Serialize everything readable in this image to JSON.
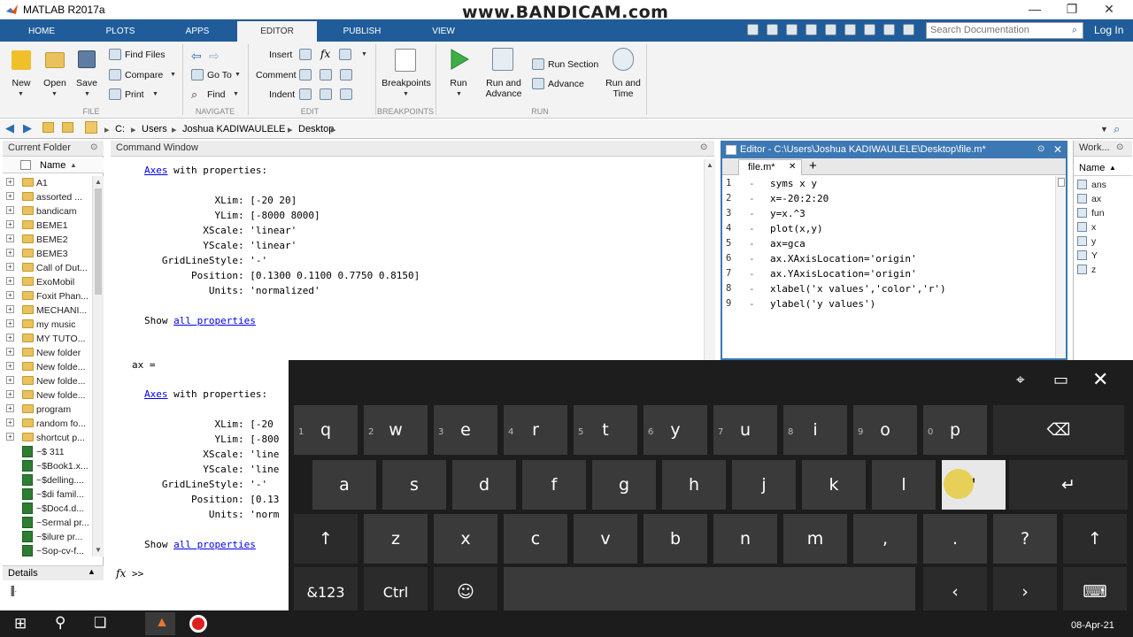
{
  "title": "MATLAB R2017a",
  "watermark": "www.BANDICAM.com",
  "tabs": [
    "HOME",
    "PLOTS",
    "APPS",
    "EDITOR",
    "PUBLISH",
    "VIEW"
  ],
  "search_placeholder": "Search Documentation",
  "login": "Log In",
  "ribbon": {
    "file": {
      "new": "New",
      "open": "Open",
      "save": "Save",
      "find_files": "Find Files",
      "compare": "Compare",
      "print": "Print",
      "group": "FILE"
    },
    "navigate": {
      "goto": "Go To",
      "find": "Find",
      "group": "NAVIGATE"
    },
    "edit": {
      "insert": "Insert",
      "comment": "Comment",
      "indent": "Indent",
      "fx": "fx",
      "group": "EDIT"
    },
    "breakpoints": {
      "label": "Breakpoints",
      "group": "BREAKPOINTS"
    },
    "run": {
      "run": "Run",
      "run_advance": "Run and Advance",
      "run_section": "Run Section",
      "advance": "Advance",
      "run_time": "Run and Time",
      "group": "RUN"
    }
  },
  "address": [
    "C:",
    "Users",
    "Joshua KADIWAULELE",
    "Desktop"
  ],
  "folder": {
    "title": "Current Folder",
    "col": "Name",
    "items": [
      {
        "name": "A1",
        "type": "folder"
      },
      {
        "name": "assorted ...",
        "type": "folder"
      },
      {
        "name": "bandicam",
        "type": "folder"
      },
      {
        "name": "BEME1",
        "type": "folder"
      },
      {
        "name": "BEME2",
        "type": "folder"
      },
      {
        "name": "BEME3",
        "type": "folder"
      },
      {
        "name": "Call of Dut...",
        "type": "folder"
      },
      {
        "name": "ExoMobil",
        "type": "folder"
      },
      {
        "name": "Foxit Phan...",
        "type": "folder"
      },
      {
        "name": "MECHANI...",
        "type": "folder"
      },
      {
        "name": "my music",
        "type": "folder"
      },
      {
        "name": "MY TUTO...",
        "type": "folder"
      },
      {
        "name": "New folder",
        "type": "folder"
      },
      {
        "name": "New folde...",
        "type": "folder"
      },
      {
        "name": "New folde...",
        "type": "folder"
      },
      {
        "name": "New folde...",
        "type": "folder"
      },
      {
        "name": "program",
        "type": "folder"
      },
      {
        "name": "random fo...",
        "type": "folder"
      },
      {
        "name": "shortcut p...",
        "type": "folder"
      },
      {
        "name": "~$ 311",
        "type": "file"
      },
      {
        "name": "~$Book1.x...",
        "type": "file"
      },
      {
        "name": "~$delling....",
        "type": "file"
      },
      {
        "name": "~$di famil...",
        "type": "file"
      },
      {
        "name": "~$Doc4.d...",
        "type": "file"
      },
      {
        "name": "~Sermal pr...",
        "type": "file"
      },
      {
        "name": "~$ilure pr...",
        "type": "file"
      },
      {
        "name": "~Sop-cv-f...",
        "type": "file"
      }
    ],
    "details": "Details"
  },
  "command": {
    "title": "Command Window",
    "axes1": {
      "label": "Axes",
      "with": " with properties:",
      "lines": [
        "            XLim: [-20 20]",
        "            YLim: [-8000 8000]",
        "          XScale: 'linear'",
        "          YScale: 'linear'",
        "   GridLineStyle: '-'",
        "        Position: [0.1300 0.1100 0.7750 0.8150]",
        "           Units: 'normalized'"
      ]
    },
    "show": "Show ",
    "all_props": "all properties",
    "ax_eq": "ax =",
    "axes2": {
      "label": "Axes",
      "with": " with properties:",
      "lines": [
        "            XLim: [-20",
        "            YLim: [-800",
        "          XScale: 'line",
        "          YScale: 'line",
        "   GridLineStyle: '-'",
        "        Position: [0.13",
        "           Units: 'norm"
      ]
    },
    "prompt": ">>",
    "fx": "fx"
  },
  "editor": {
    "title": "Editor - C:\\Users\\Joshua KADIWAULELE\\Desktop\\file.m*",
    "tab": "file.m*",
    "lines": [
      "syms x y",
      "x=-20:2:20",
      "y=x.^3",
      "plot(x,y)",
      "ax=gca",
      "ax.XAxisLocation='origin'",
      "ax.YAxisLocation='origin'",
      "xlabel('x values','color','r')",
      "ylabel('y values')"
    ]
  },
  "workspace": {
    "title": "Work...",
    "col": "Name",
    "vars": [
      "ans",
      "ax",
      "fun",
      "x",
      "y",
      "Y",
      "z"
    ]
  },
  "keyboard": {
    "row1": [
      {
        "k": "q",
        "h": "1"
      },
      {
        "k": "w",
        "h": "2"
      },
      {
        "k": "e",
        "h": "3"
      },
      {
        "k": "r",
        "h": "4"
      },
      {
        "k": "t",
        "h": "5"
      },
      {
        "k": "y",
        "h": "6"
      },
      {
        "k": "u",
        "h": "7"
      },
      {
        "k": "i",
        "h": "8"
      },
      {
        "k": "o",
        "h": "9"
      },
      {
        "k": "p",
        "h": "0"
      }
    ],
    "row2": [
      "a",
      "s",
      "d",
      "f",
      "g",
      "h",
      "j",
      "k",
      "l",
      "'"
    ],
    "row3": [
      "z",
      "x",
      "c",
      "v",
      "b",
      "n",
      "m",
      ",",
      ".",
      "?"
    ],
    "sym": "&123",
    "ctrl": "Ctrl"
  },
  "taskbar": {
    "date": "08-Apr-21"
  }
}
